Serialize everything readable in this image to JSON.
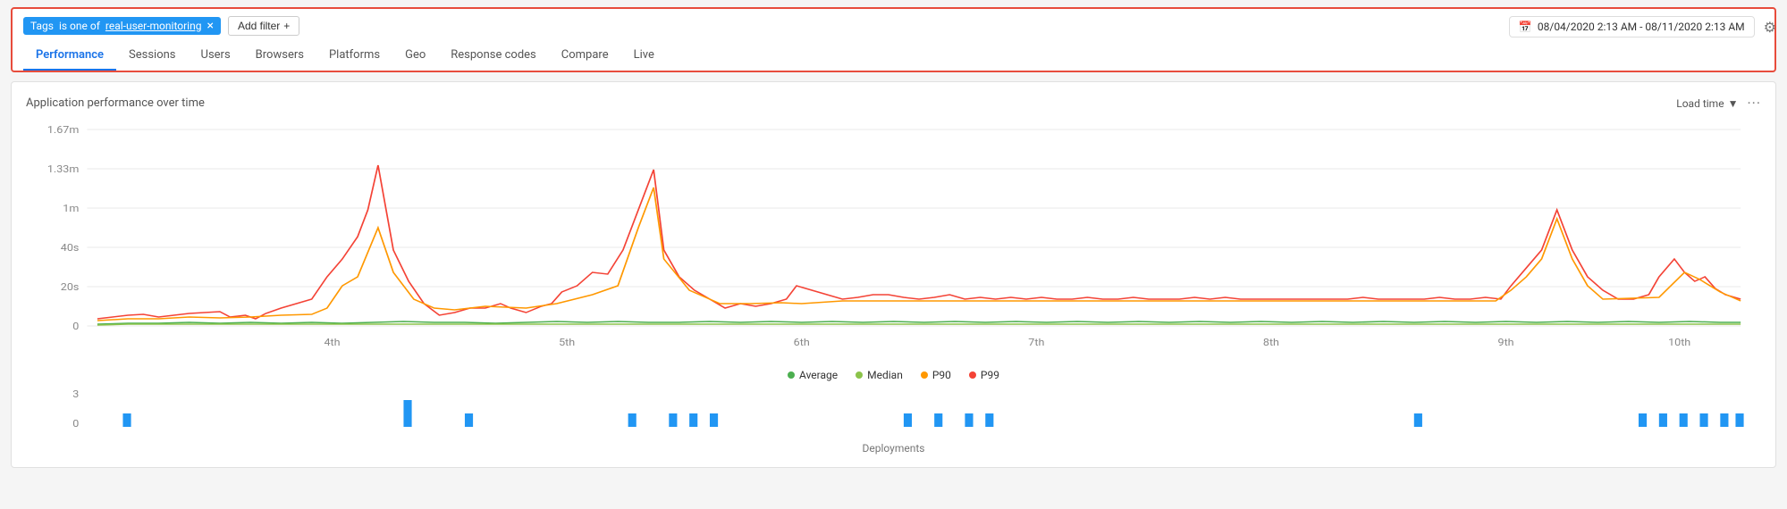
{
  "header": {
    "filter": {
      "label": "Tags",
      "condition": "is one of",
      "value": "real-user-monitoring",
      "add_filter_label": "Add filter"
    },
    "date_range": "08/04/2020 2:13 AM - 08/11/2020 2:13 AM"
  },
  "tabs": [
    {
      "label": "Performance",
      "active": true
    },
    {
      "label": "Sessions",
      "active": false
    },
    {
      "label": "Users",
      "active": false
    },
    {
      "label": "Browsers",
      "active": false
    },
    {
      "label": "Platforms",
      "active": false
    },
    {
      "label": "Geo",
      "active": false
    },
    {
      "label": "Response codes",
      "active": false
    },
    {
      "label": "Compare",
      "active": false
    },
    {
      "label": "Live",
      "active": false
    }
  ],
  "chart": {
    "title": "Application performance over time",
    "load_time_label": "Load time",
    "y_axis_labels": [
      "1.67m",
      "1.33m",
      "1m",
      "40s",
      "20s",
      "0"
    ],
    "x_axis_labels": [
      "4th",
      "5th",
      "6th",
      "7th",
      "8th",
      "9th",
      "10th"
    ],
    "legend": [
      {
        "label": "Average",
        "color": "#4caf50"
      },
      {
        "label": "Median",
        "color": "#8bc34a"
      },
      {
        "label": "P90",
        "color": "#ff9800"
      },
      {
        "label": "P99",
        "color": "#f44336"
      }
    ],
    "deployments_label": "Deployments"
  },
  "icons": {
    "calendar": "📅",
    "gear": "⚙",
    "chevron_down": "▼",
    "plus": "+",
    "more": "···"
  }
}
